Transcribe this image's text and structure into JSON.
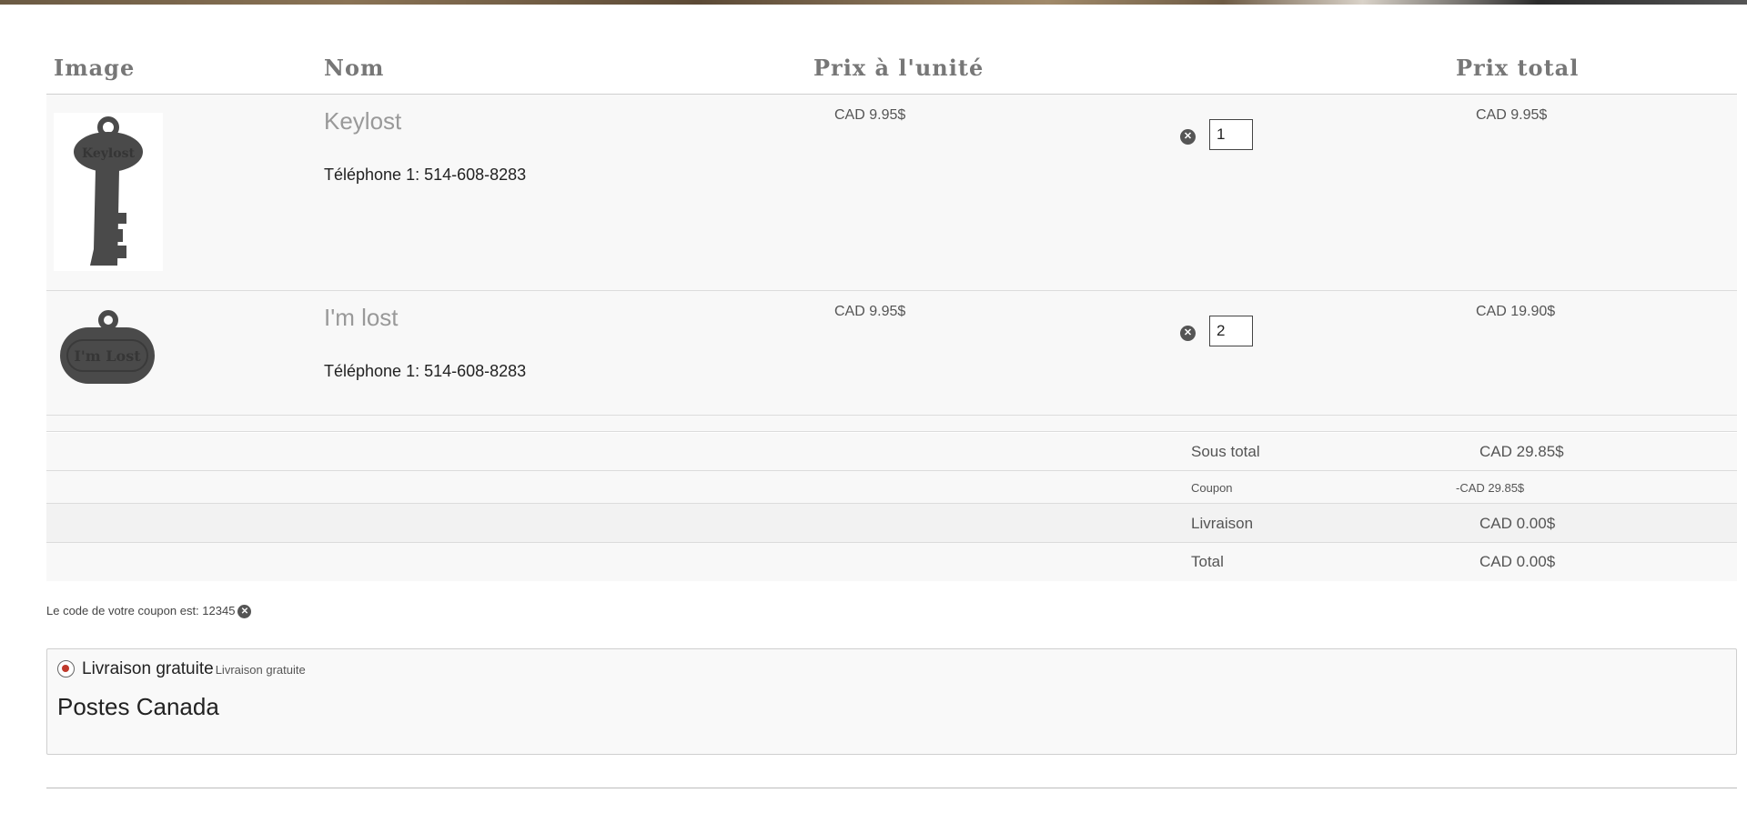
{
  "headers": {
    "image": "Image",
    "name": "Nom",
    "unit_price": "Prix à l'unité",
    "total_price": "Prix total"
  },
  "items": [
    {
      "name": "Keylost",
      "phone": "Téléphone 1: 514-608-8283",
      "unit_price": "CAD 9.95$",
      "quantity": "1",
      "total": "CAD 9.95$",
      "image_icon": "key-keychain-icon",
      "image_text": "Keylost"
    },
    {
      "name": "I'm lost",
      "phone": "Téléphone 1: 514-608-8283",
      "unit_price": "CAD 9.95$",
      "quantity": "2",
      "total": "CAD 19.90$",
      "image_icon": "tag-keychain-icon",
      "image_text": "I'm Lost"
    }
  ],
  "summary": {
    "subtotal_label": "Sous total",
    "subtotal_value": "CAD 29.85$",
    "coupon_label": "Coupon",
    "coupon_value": "-CAD 29.85$",
    "shipping_label": "Livraison",
    "shipping_value": "CAD 0.00$",
    "total_label": "Total",
    "total_value": "CAD 0.00$"
  },
  "coupon_note": "Le code de votre coupon est: 12345",
  "shipping": {
    "option_label": "Livraison gratuite",
    "option_sub": "Livraison gratuite",
    "carrier": "Postes Canada"
  },
  "colors": {
    "product": "#4a4a4a",
    "radio_dot": "#c0392b"
  }
}
